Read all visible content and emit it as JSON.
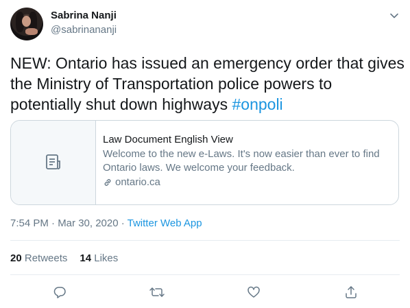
{
  "author": {
    "display_name": "Sabrina Nanji",
    "handle": "@sabrinananji"
  },
  "tweet": {
    "text": "NEW: Ontario has issued an emergency order that gives the Ministry of Transportation police powers to potentially shut down highways ",
    "hashtag": "#onpoli"
  },
  "card": {
    "icon": "document-icon",
    "title": "Law Document English View",
    "description": "Welcome to the new e-Laws. It's now easier than ever to find Ontario laws. We welcome your feedback.",
    "domain": "ontario.ca"
  },
  "meta": {
    "timestamp": "7:54 PM · Mar 30, 2020 · ",
    "source": "Twitter Web App"
  },
  "stats": {
    "retweets_count": "20",
    "retweets_label": "Retweets",
    "likes_count": "14",
    "likes_label": "Likes"
  },
  "actions": [
    "reply-icon",
    "retweet-icon",
    "like-icon",
    "share-icon"
  ],
  "colors": {
    "link": "#1b95e0",
    "secondary_text": "#657786",
    "primary_text": "#14171a",
    "border": "#ccd6dd"
  }
}
